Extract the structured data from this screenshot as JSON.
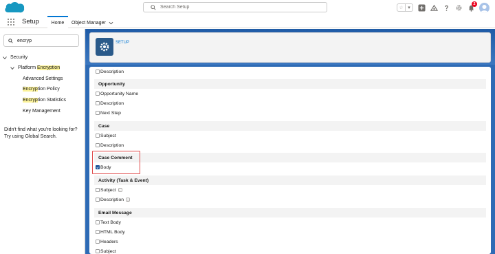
{
  "header": {
    "search_placeholder": "Search Setup",
    "notification_count": "2"
  },
  "context_bar": {
    "app_name": "Setup",
    "tabs": [
      {
        "label": "Home"
      },
      {
        "label": "Object Manager"
      }
    ]
  },
  "sidebar": {
    "quick_find_value": "encryp",
    "tree": {
      "security": "Security",
      "platform_prefix": "Platform ",
      "platform_match": "Encryption",
      "advanced_settings": "Advanced Settings",
      "policy_match": "Encryp",
      "policy_rest": "tion Policy",
      "stats_match": "Encryp",
      "stats_rest": "tion Statistics",
      "key_management": "Key Management"
    },
    "not_found_line1": "Didn't find what you're looking for?",
    "not_found_line2": "Try using Global Search."
  },
  "main": {
    "setup_label": "SETUP",
    "top_field": "Description",
    "sections": [
      {
        "title": "Opportunity",
        "fields": [
          "Opportunity Name",
          "Description",
          "Next Step"
        ]
      },
      {
        "title": "Case",
        "fields": [
          "Subject",
          "Description"
        ]
      },
      {
        "title": "Case Comment",
        "fields": [
          "Body"
        ]
      },
      {
        "title": "Activity (Task & Event)",
        "fields": [
          "Subject",
          "Description"
        ]
      },
      {
        "title": "Email Message",
        "fields": [
          "Text Body",
          "HTML Body",
          "Headers",
          "Subject"
        ]
      }
    ],
    "checked": {
      "case_comment_body": true
    },
    "info_glyph": "i"
  },
  "colors": {
    "brand_blue": "#0176d3",
    "setup_background": "#2e6bb5",
    "highlight_box": "#e04848",
    "search_highlight": "#fcf39a"
  }
}
